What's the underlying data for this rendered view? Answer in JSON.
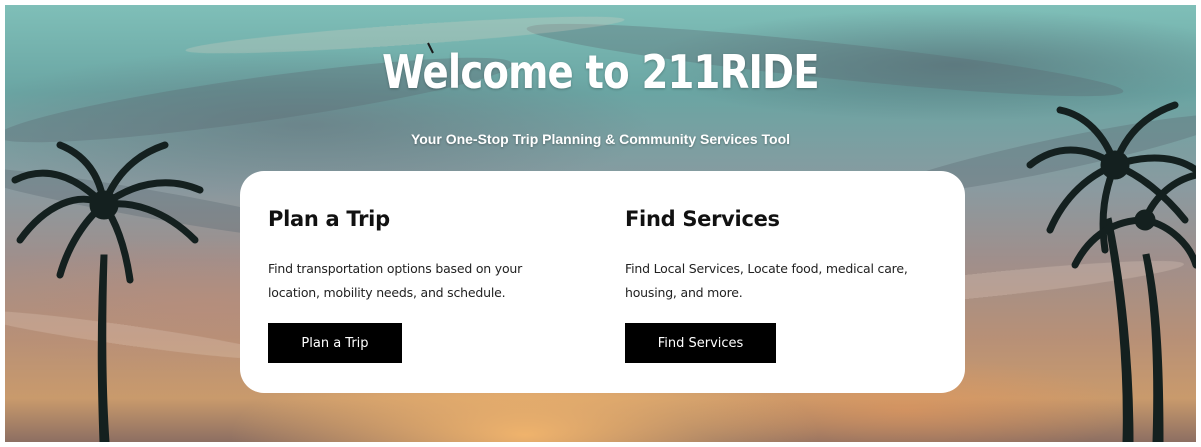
{
  "hero": {
    "title": "Welcome to 211RIDE",
    "subtitle": "Your One-Stop Trip Planning & Community Services Tool"
  },
  "plan_trip": {
    "heading": "Plan a Trip",
    "description": "Find transportation options based on your location, mobility needs, and schedule.",
    "button_label": "Plan a Trip"
  },
  "find_services": {
    "heading": "Find Services",
    "description": "Find Local Services, Locate food, medical care, housing, and more.",
    "button_label": "Find Services"
  },
  "colors": {
    "card_background": "#ffffff",
    "button_background": "#000000",
    "button_text": "#ffffff",
    "palm_silhouette": "#14201f"
  }
}
